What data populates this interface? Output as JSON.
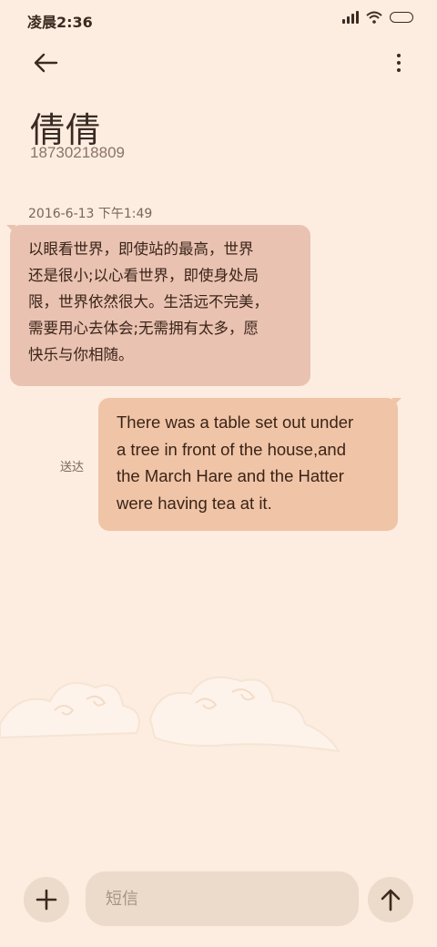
{
  "status_bar": {
    "time": "凌晨2:36"
  },
  "header": {
    "back_icon": "back-arrow-icon",
    "more_icon": "more-vertical-icon"
  },
  "contact": {
    "name": "倩倩",
    "phone": "18730218809"
  },
  "conversation": {
    "date": "2016-6-13 下午1:49",
    "incoming_message": {
      "lines": [
        "以眼看世界，即使站的最高，世界",
        "还是很小;以心看世界，即使身处局",
        "限，世界依然很大。生活远不完美，",
        "需要用心去体会;无需拥有太多，愿",
        "快乐与你相随。"
      ]
    },
    "outgoing_message": {
      "lines": [
        "There was a table set out under",
        "a tree in front of the house,and",
        "the March Hare and the Hatter",
        "were having tea at it."
      ],
      "status": "送达"
    }
  },
  "composer": {
    "placeholder": "短信",
    "attach_icon": "plus-icon",
    "send_icon": "send-arrow-icon"
  },
  "colors": {
    "background": "#fcede0",
    "incoming_bubble": "#e9c2b2",
    "outgoing_bubble": "#f0c4a6",
    "control_bg": "#ecdacb"
  }
}
